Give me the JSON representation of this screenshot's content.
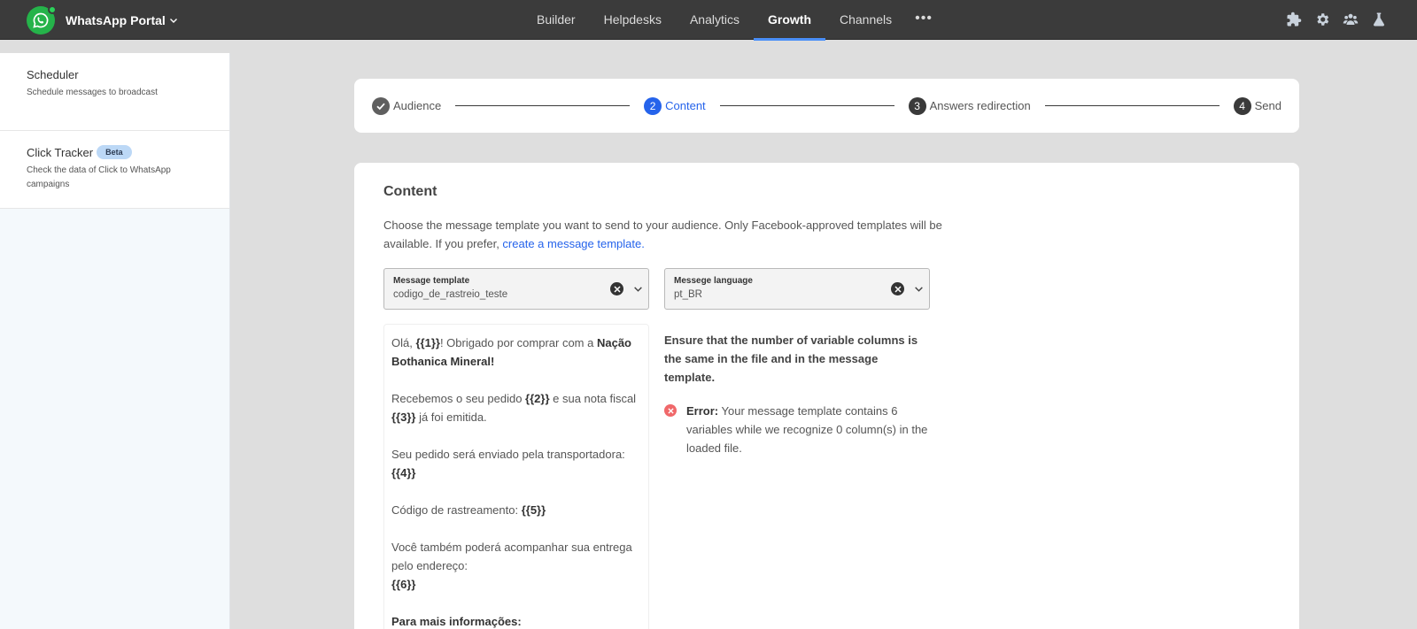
{
  "header": {
    "app_name": "WhatsApp Portal",
    "nav": [
      "Builder",
      "Helpdesks",
      "Analytics",
      "Growth",
      "Channels"
    ],
    "active_nav": "Growth",
    "more": "•••",
    "icons": [
      "puzzle-icon",
      "gear-icon",
      "team-icon",
      "flask-icon"
    ]
  },
  "sidebar": {
    "items": [
      {
        "title": "Scheduler",
        "desc": "Schedule messages to broadcast"
      },
      {
        "title": "Click Tracker",
        "badge": "Beta",
        "desc": "Check the data of Click to WhatsApp campaigns"
      }
    ]
  },
  "stepper": {
    "steps": [
      {
        "num": "",
        "label": "Audience",
        "state": "done"
      },
      {
        "num": "2",
        "label": "Content",
        "state": "active"
      },
      {
        "num": "3",
        "label": "Answers redirection",
        "state": "pending"
      },
      {
        "num": "4",
        "label": "Send",
        "state": "pending"
      }
    ]
  },
  "content": {
    "title": "Content",
    "desc": "Choose the message template you want to send to your audience. Only Facebook-approved templates will be available. If you prefer, ",
    "link": "create a message template.",
    "template_select": {
      "label": "Message template",
      "value": "codigo_de_rastreio_teste"
    },
    "language_select": {
      "label": "Messege language",
      "value": "pt_BR"
    },
    "preview": {
      "p1_a": "Olá, ",
      "p1_var": "{{1}}",
      "p1_b": "! Obrigado por comprar com a ",
      "p1_bold": "Nação Bothanica Mineral!",
      "p2_a": "Recebemos o seu pedido ",
      "p2_var1": "{{2}}",
      "p2_b": " e sua nota fiscal ",
      "p2_var2": "{{3}}",
      "p2_c": " já foi emitida.",
      "p3_a": "Seu pedido será enviado pela transportadora:",
      "p3_var": "{{4}}",
      "p4_a": "Código de rastreamento: ",
      "p4_var": "{{5}}",
      "p5_a": "Você também poderá acompanhar sua entrega pelo endereço:",
      "p5_var": "{{6}}",
      "p6_bold": "Para mais informações:"
    },
    "warning": "Ensure that the number of variable columns is the same in the file and in the message template.",
    "error_label": "Error:",
    "error_text": " Your message template contains 6 variables while we recognize 0 column(s) in the loaded file."
  }
}
